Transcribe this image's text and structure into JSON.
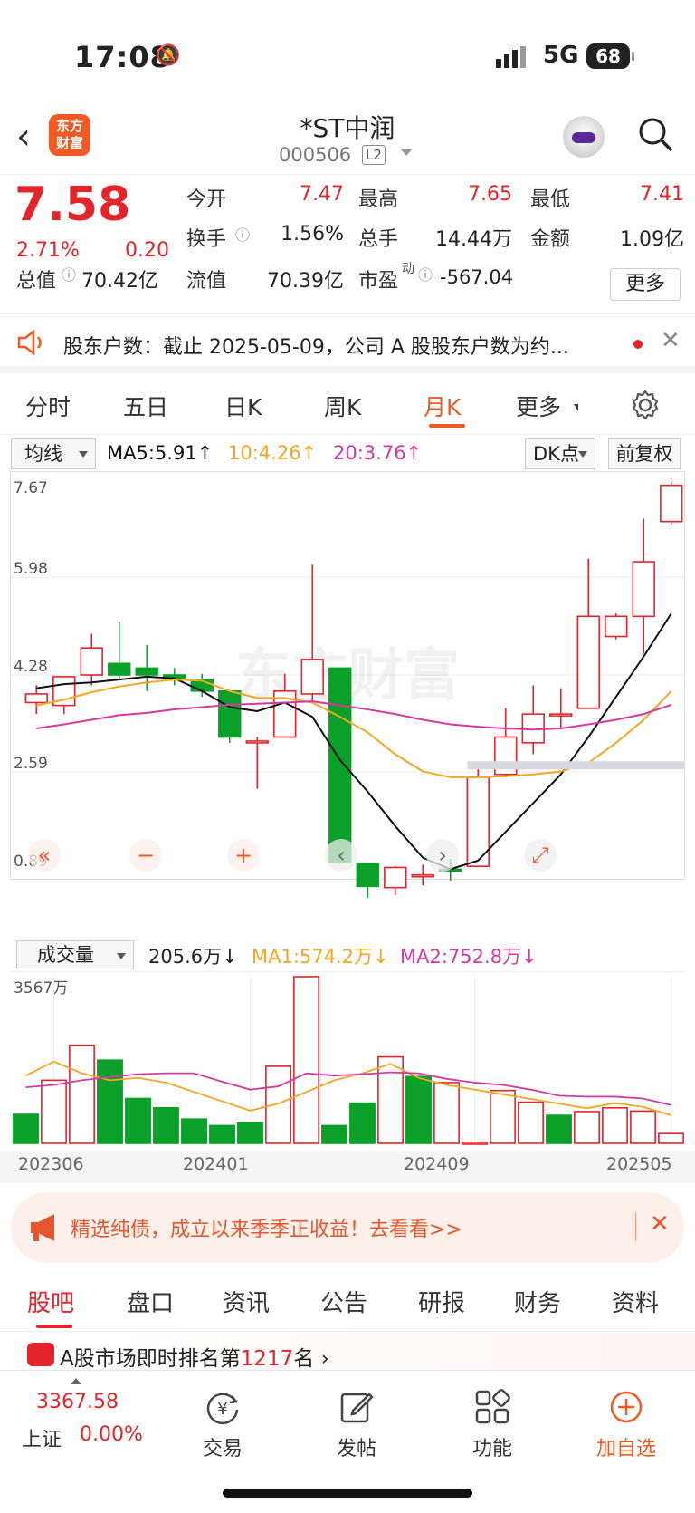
{
  "status_bar": {
    "time": "17:08",
    "network": "5G",
    "battery": "68"
  },
  "header": {
    "logo_text": "东方\n财富",
    "title": "*ST中润",
    "code": "000506",
    "level": "L2"
  },
  "quote": {
    "price": "7.58",
    "change_pct": "2.71%",
    "change": "0.20",
    "open_label": "今开",
    "open": "7.47",
    "high_label": "最高",
    "high": "7.65",
    "low_label": "最低",
    "low": "7.41",
    "turnover_label": "换手",
    "turnover": "1.56%",
    "volume_label": "总手",
    "volume": "14.44万",
    "amount_label": "金额",
    "amount": "1.09亿",
    "mktcap_label": "总值",
    "mktcap": "70.42亿",
    "float_label": "流值",
    "float": "70.39亿",
    "pe_label": "市盈",
    "pe_sup": "动",
    "pe": "-567.04",
    "more": "更多"
  },
  "notice": {
    "text": "股东户数：截止 2025-05-09，公司 A 股股东户数为约..."
  },
  "tabs": [
    "分时",
    "五日",
    "日K",
    "周K",
    "月K",
    "更多"
  ],
  "active_tab": "月K",
  "ma_row": {
    "selector": "均线",
    "ma5": "MA5:5.91↑",
    "ma10": "10:4.26↑",
    "ma20": "20:3.76↑",
    "dk": "DK点",
    "fq": "前复权"
  },
  "colors": {
    "up": "#e4242b",
    "down": "#0aa02a",
    "ma5": "#111111",
    "ma10": "#f5a623",
    "ma20": "#d63aa0",
    "accent": "#f15a24"
  },
  "vol_row": {
    "selector": "成交量",
    "vol": "205.6万↓",
    "ma1": "MA1:574.2万↓",
    "ma2": "MA2:752.8万↓"
  },
  "chart_data": [
    {
      "type": "candlestick",
      "y_ticks": [
        "7.67",
        "5.98",
        "4.28",
        "2.59",
        "0.89"
      ],
      "ylim": [
        0.89,
        7.67
      ],
      "watermark": "东方财富",
      "candles": [
        {
          "o": 3.8,
          "h": 4.1,
          "l": 3.6,
          "c": 3.95
        },
        {
          "o": 3.75,
          "h": 4.25,
          "l": 3.6,
          "c": 4.25
        },
        {
          "o": 4.28,
          "h": 5.0,
          "l": 4.1,
          "c": 4.75
        },
        {
          "o": 4.48,
          "h": 5.2,
          "l": 4.2,
          "c": 4.28
        },
        {
          "o": 4.4,
          "h": 4.8,
          "l": 4.0,
          "c": 4.28
        },
        {
          "o": 4.28,
          "h": 4.4,
          "l": 4.1,
          "c": 4.22
        },
        {
          "o": 4.2,
          "h": 4.3,
          "l": 3.9,
          "c": 4.0
        },
        {
          "o": 4.0,
          "h": 4.0,
          "l": 3.1,
          "c": 3.2
        },
        {
          "o": 3.1,
          "h": 3.2,
          "l": 2.3,
          "c": 3.13
        },
        {
          "o": 3.2,
          "h": 4.3,
          "l": 3.2,
          "c": 4.0
        },
        {
          "o": 3.95,
          "h": 6.2,
          "l": 3.8,
          "c": 4.55
        },
        {
          "o": 4.4,
          "h": 4.4,
          "l": 1.0,
          "c": 1.02
        },
        {
          "o": 1.0,
          "h": 1.0,
          "l": 0.4,
          "c": 0.6
        },
        {
          "o": 0.58,
          "h": 0.95,
          "l": 0.45,
          "c": 0.93
        },
        {
          "o": 0.78,
          "h": 0.98,
          "l": 0.62,
          "c": 0.8
        },
        {
          "o": 0.9,
          "h": 1.08,
          "l": 0.7,
          "c": 0.88
        },
        {
          "o": 0.95,
          "h": 2.7,
          "l": 0.95,
          "c": 2.5
        },
        {
          "o": 2.55,
          "h": 3.7,
          "l": 2.5,
          "c": 3.2
        },
        {
          "o": 3.1,
          "h": 4.1,
          "l": 2.9,
          "c": 3.6
        },
        {
          "o": 3.6,
          "h": 4.05,
          "l": 3.35,
          "c": 3.6
        },
        {
          "o": 3.7,
          "h": 6.3,
          "l": 3.7,
          "c": 5.3
        },
        {
          "o": 4.95,
          "h": 5.35,
          "l": 4.9,
          "c": 5.3
        },
        {
          "o": 5.3,
          "h": 7.0,
          "l": 4.65,
          "c": 6.25
        },
        {
          "o": 6.95,
          "h": 7.65,
          "l": 6.9,
          "c": 7.58
        }
      ],
      "ma5": [
        4.05,
        4.12,
        4.15,
        4.2,
        4.25,
        4.22,
        4.0,
        3.72,
        3.65,
        3.8,
        3.55,
        2.8,
        2.25,
        1.65,
        1.1,
        0.9,
        1.05,
        1.55,
        2.05,
        2.55,
        3.2,
        3.9,
        4.6,
        5.35
      ],
      "ma10": [
        3.75,
        3.85,
        3.98,
        4.08,
        4.15,
        4.2,
        4.18,
        4.0,
        3.88,
        3.88,
        3.8,
        3.55,
        3.28,
        2.9,
        2.6,
        2.5,
        2.5,
        2.52,
        2.55,
        2.6,
        2.75,
        3.1,
        3.5,
        4.0
      ],
      "ma20": [
        3.35,
        3.42,
        3.5,
        3.58,
        3.62,
        3.68,
        3.72,
        3.76,
        3.78,
        3.8,
        3.82,
        3.75,
        3.68,
        3.6,
        3.5,
        3.42,
        3.38,
        3.35,
        3.33,
        3.35,
        3.42,
        3.5,
        3.6,
        3.76
      ]
    },
    {
      "type": "bar",
      "y_ticks": [
        "3567万"
      ],
      "ylim": [
        0,
        3567
      ],
      "x_ticks": [
        "202306",
        "202401",
        "202409",
        "202505"
      ],
      "volumes": [
        620,
        1350,
        2100,
        1780,
        960,
        760,
        520,
        380,
        450,
        1650,
        3567,
        380,
        860,
        1850,
        1430,
        1300,
        20,
        1130,
        880,
        600,
        680,
        760,
        690,
        210
      ],
      "up": [
        false,
        true,
        true,
        false,
        false,
        false,
        false,
        false,
        false,
        true,
        true,
        false,
        false,
        true,
        false,
        true,
        true,
        true,
        true,
        false,
        true,
        true,
        true,
        true
      ],
      "ma1": [
        1450,
        1750,
        1500,
        1350,
        1400,
        1300,
        1100,
        900,
        700,
        850,
        1100,
        1350,
        1500,
        1700,
        1400,
        1250,
        1150,
        1050,
        950,
        850,
        750,
        860,
        780,
        600
      ],
      "ma2": [
        1200,
        1250,
        1350,
        1420,
        1480,
        1500,
        1500,
        1320,
        1150,
        1220,
        1500,
        1450,
        1480,
        1520,
        1500,
        1380,
        1300,
        1250,
        1150,
        1020,
        1000,
        1000,
        960,
        820
      ]
    }
  ],
  "ad": {
    "text": "精选纯债，成立以来季季正收益！去看看>>"
  },
  "subtabs": [
    "股吧",
    "盘口",
    "资讯",
    "公告",
    "研报",
    "财务",
    "资料"
  ],
  "rank": {
    "text_a": "A股市场即时排名第",
    "rank": "1217",
    "text_b": "名"
  },
  "bottom_bar": {
    "index_value": "3367.58",
    "index_name": "上证",
    "index_pct": "0.00%",
    "trade": "交易",
    "post": "发帖",
    "func": "功能",
    "watch": "加自选"
  }
}
